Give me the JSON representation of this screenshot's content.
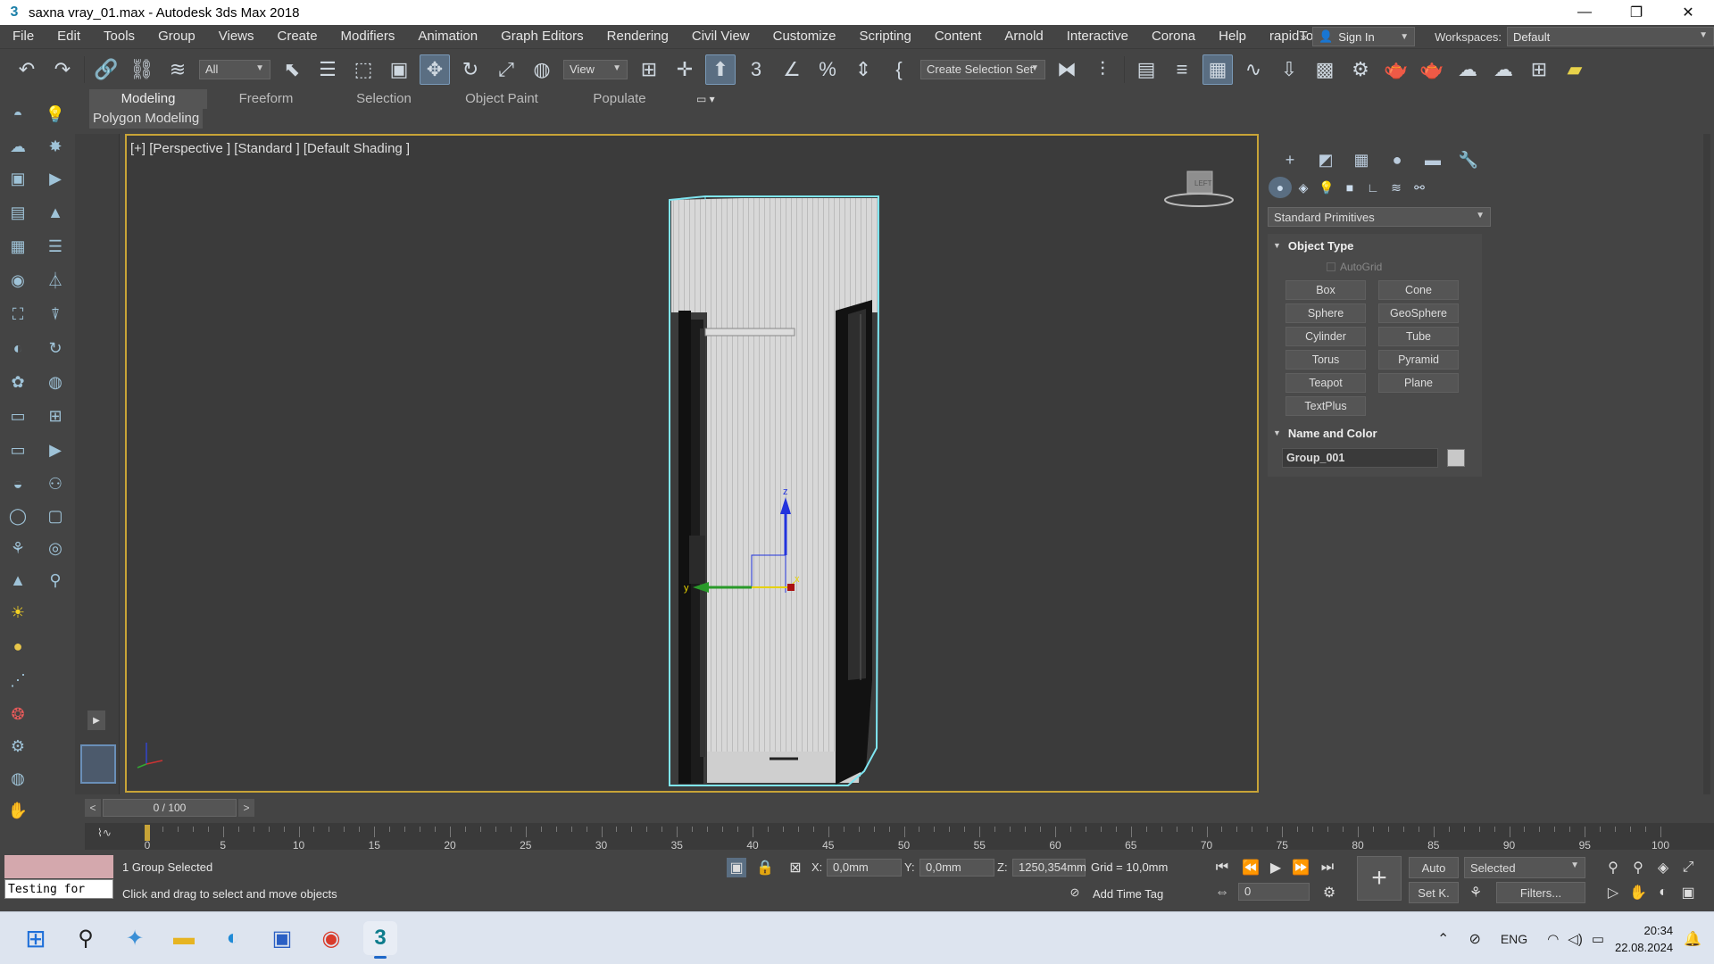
{
  "window": {
    "title": "saxna vray_01.max - Autodesk 3ds Max 2018",
    "controls": [
      "—",
      "❐",
      "✕"
    ]
  },
  "menu": {
    "items": [
      "File",
      "Edit",
      "Tools",
      "Group",
      "Views",
      "Create",
      "Modifiers",
      "Animation",
      "Graph Editors",
      "Rendering",
      "Civil View",
      "Customize",
      "Scripting",
      "Content",
      "Arnold",
      "Interactive",
      "Corona",
      "Help",
      "rapidTools"
    ],
    "overflow": "»",
    "sign_in": "Sign In",
    "workspaces_label": "Workspaces:",
    "workspace_value": "Default"
  },
  "toolbar": {
    "filter_value": "All",
    "refcoord_value": "View",
    "selection_set_placeholder": "Create Selection Set"
  },
  "ribbon": {
    "tabs": [
      "Modeling",
      "Freeform",
      "Selection",
      "Object Paint",
      "Populate"
    ],
    "active_tab": "Modeling",
    "sub_label": "Polygon Modeling"
  },
  "viewport": {
    "label": "[+] [Perspective ] [Standard ] [Default Shading ]",
    "border_color": "#c8a437",
    "selection_color": "#7fe6f2",
    "gizmo_labels": {
      "z": "z",
      "y": "y",
      "x": "x"
    }
  },
  "command_panel": {
    "primitive_type": "Standard Primitives",
    "object_type_title": "Object Type",
    "autogrid_label": "AutoGrid",
    "primitives": [
      "Box",
      "Cone",
      "Sphere",
      "GeoSphere",
      "Cylinder",
      "Tube",
      "Torus",
      "Pyramid",
      "Teapot",
      "Plane",
      "TextPlus"
    ],
    "name_color_title": "Name and Color",
    "object_name": "Group_001"
  },
  "timeline": {
    "frame_display": "0 / 100",
    "prev": "<",
    "next": ">",
    "tick_labels": [
      "0",
      "5",
      "10",
      "15",
      "20",
      "25",
      "30",
      "35",
      "40",
      "45",
      "50",
      "55",
      "60",
      "65",
      "70",
      "75",
      "80",
      "85",
      "90",
      "95",
      "100"
    ]
  },
  "status": {
    "selection_info": "1 Group Selected",
    "prompt": "Click and drag to select and move objects",
    "listener_text": "Testing for",
    "x_label": "X:",
    "x_value": "0,0mm",
    "y_label": "Y:",
    "y_value": "0,0mm",
    "z_label": "Z:",
    "z_value": "1250,354mm",
    "grid": "Grid = 10,0mm",
    "add_time_tag": "Add Time Tag",
    "auto_key": "Auto",
    "set_key": "Set K.",
    "key_filter_value": "Selected",
    "filters": "Filters...",
    "frame_field": "0"
  },
  "taskbar": {
    "language": "ENG",
    "time": "20:34",
    "date": "22.08.2024"
  }
}
